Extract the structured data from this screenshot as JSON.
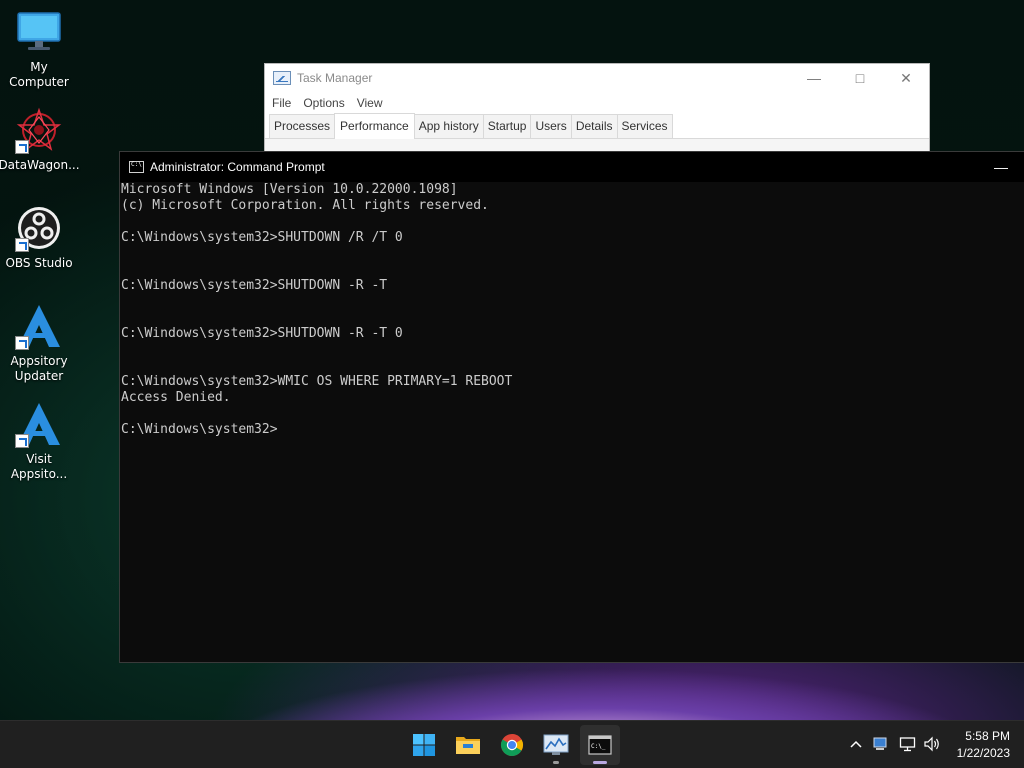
{
  "desktop": {
    "icons": [
      {
        "label": "My Computer",
        "icon": "monitor-icon"
      },
      {
        "label": "DataWagon...",
        "icon": "datawagon-icon"
      },
      {
        "label": "OBS Studio",
        "icon": "obs-icon"
      },
      {
        "label": "Appsitory Updater",
        "icon": "appsitory-icon"
      },
      {
        "label": "Visit Appsito...",
        "icon": "appsitory-icon"
      }
    ]
  },
  "taskmanager": {
    "title": "Task Manager",
    "menu": [
      "File",
      "Options",
      "View"
    ],
    "tabs": [
      "Processes",
      "Performance",
      "App history",
      "Startup",
      "Users",
      "Details",
      "Services"
    ],
    "active_tab": "Performance"
  },
  "cmd": {
    "title": "Administrator: Command Prompt",
    "lines": [
      "Microsoft Windows [Version 10.0.22000.1098]",
      "(c) Microsoft Corporation. All rights reserved.",
      "",
      "C:\\Windows\\system32>SHUTDOWN /R /T 0",
      "",
      "",
      "C:\\Windows\\system32>SHUTDOWN -R -T",
      "",
      "",
      "C:\\Windows\\system32>SHUTDOWN -R -T 0",
      "",
      "",
      "C:\\Windows\\system32>WMIC OS WHERE PRIMARY=1 REBOOT",
      "Access Denied.",
      "",
      "C:\\Windows\\system32>"
    ]
  },
  "taskbar": {
    "apps": [
      "start-icon",
      "file-explorer-icon",
      "chrome-icon",
      "task-manager-icon",
      "command-prompt-icon"
    ],
    "clock": {
      "time": "5:58 PM",
      "date": "1/22/2023"
    }
  },
  "colors": {
    "accent": "#0078d4",
    "console_bg": "#0c0c0c",
    "console_fg": "#cccccc",
    "taskbar_bg": "#202020"
  }
}
